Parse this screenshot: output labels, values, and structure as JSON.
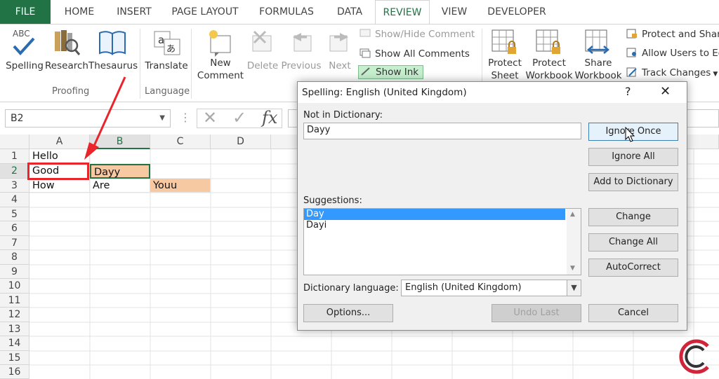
{
  "tabs": [
    "FILE",
    "HOME",
    "INSERT",
    "PAGE LAYOUT",
    "FORMULAS",
    "DATA",
    "REVIEW",
    "VIEW",
    "DEVELOPER"
  ],
  "ribbon": {
    "spelling": "Spelling",
    "spelling_abc": "ABC",
    "research": "Research",
    "thesaurus": "Thesaurus",
    "proofing": "Proofing",
    "translate": "Translate",
    "language": "Language",
    "new_comment_1": "New",
    "new_comment_2": "Comment",
    "delete": "Delete",
    "previous": "Previous",
    "next": "Next",
    "show_hide_comment": "Show/Hide Comment",
    "show_all_comments": "Show All Comments",
    "show_ink": "Show Ink",
    "protect_sheet_1": "Protect",
    "protect_sheet_2": "Sheet",
    "protect_workbook_1": "Protect",
    "protect_workbook_2": "Workbook",
    "share_workbook_1": "Share",
    "share_workbook_2": "Workbook",
    "protect_and_share": "Protect and Share",
    "allow_users": "Allow Users to Ed",
    "track_changes": "Track Changes"
  },
  "formula_bar": {
    "name_box": "B2",
    "fx": "fx"
  },
  "sheet": {
    "columns": [
      "A",
      "B",
      "C",
      "D"
    ],
    "rows": [
      "1",
      "2",
      "3",
      "4",
      "5",
      "6",
      "7",
      "8",
      "9",
      "10",
      "11",
      "12",
      "13",
      "14",
      "15",
      "16"
    ],
    "cells": {
      "A1": "Hello",
      "A2": "Good",
      "B2": "Dayy",
      "A3": "How",
      "B3": "Are",
      "C3": "Youu"
    }
  },
  "dialog": {
    "title": "Spelling: English (United Kingdom)",
    "help": "?",
    "close": "✕",
    "not_in_dictionary_label": "Not in Dictionary:",
    "not_in_dictionary_value": "Dayy",
    "suggestions_label": "Suggestions:",
    "suggestions": [
      "Day",
      "Dayi"
    ],
    "dictionary_language_label": "Dictionary language:",
    "dictionary_language_value": "English (United Kingdom)",
    "buttons": {
      "ignore_once": "Ignore Once",
      "ignore_all": "Ignore All",
      "add_to_dictionary": "Add to Dictionary",
      "change": "Change",
      "change_all": "Change All",
      "autocorrect": "AutoCorrect",
      "options": "Options...",
      "undo_last": "Undo Last",
      "cancel": "Cancel"
    }
  },
  "colors": {
    "excel_green": "#217346",
    "highlight_orange": "#f7c9a3",
    "annotation_red": "#e8252a"
  }
}
